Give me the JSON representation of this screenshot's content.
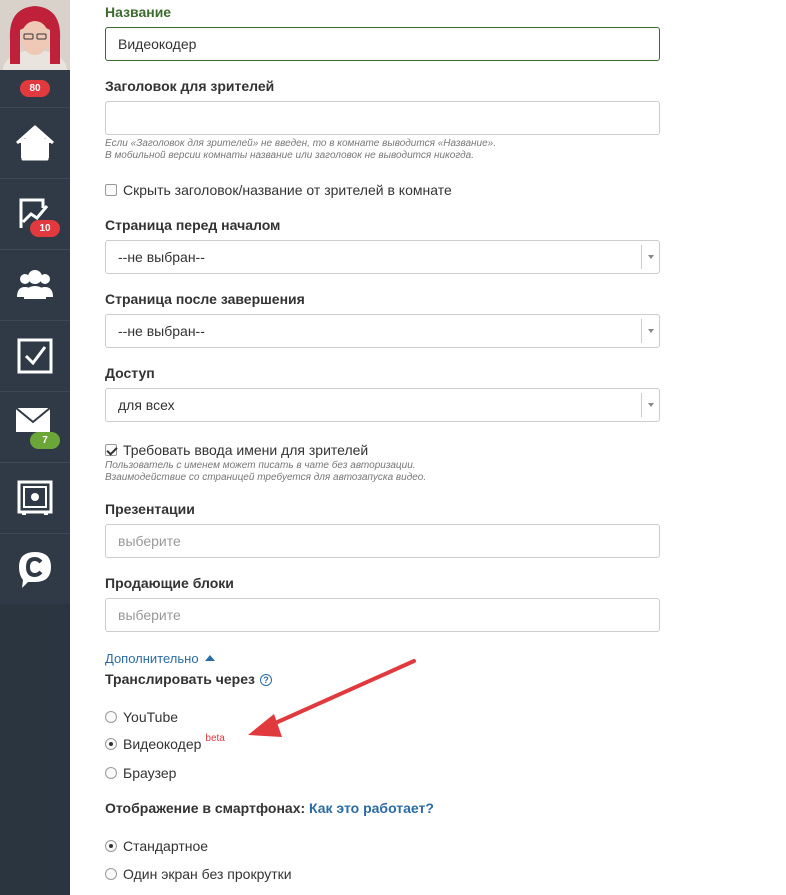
{
  "sidebar": {
    "avatar_badge": "80",
    "items": [
      {
        "icon": "home-icon",
        "badge": ""
      },
      {
        "icon": "chart-icon",
        "badge": "10"
      },
      {
        "icon": "users-icon",
        "badge": ""
      },
      {
        "icon": "checkbox-icon",
        "badge": ""
      },
      {
        "icon": "mail-icon",
        "badge": "7"
      },
      {
        "icon": "safe-icon",
        "badge": ""
      },
      {
        "icon": "chat-c-icon",
        "badge": ""
      }
    ]
  },
  "form": {
    "name_label": "Название",
    "name_value": "Видеокодер",
    "title_label": "Заголовок для зрителей",
    "title_value": "",
    "title_hint_1": "Если «Заголовок для зрителей» не введен, то в комнате выводится «Название».",
    "title_hint_2": "В мобильной версии комнаты название или заголовок не выводится никогда.",
    "hide_title_label": "Скрыть заголовок/название от зрителей в комнате",
    "page_before_label": "Страница перед началом",
    "page_before_value": "--не выбран--",
    "page_after_label": "Страница после завершения",
    "page_after_value": "--не выбран--",
    "access_label": "Доступ",
    "access_value": "для всех",
    "require_name_label": "Требовать ввода имени для зрителей",
    "require_name_hint_1": "Пользователь с именем может писать в чате без авторизации.",
    "require_name_hint_2": "Взаимодействие со страницей требуется для автозапуска видео.",
    "presentations_label": "Презентации",
    "presentations_placeholder": "выберите",
    "selling_label": "Продающие блоки",
    "selling_placeholder": "выберите",
    "more_link": "Дополнительно",
    "broadcast_label": "Транслировать через",
    "broadcast_help": "?",
    "broadcast_options": [
      {
        "label": "YouTube",
        "selected": false
      },
      {
        "label": "Видеокодер",
        "selected": true,
        "tag": "beta"
      },
      {
        "label": "Браузер",
        "selected": false
      }
    ],
    "mobile_label": "Отображение в смартфонах:",
    "mobile_link": "Как это работает?",
    "mobile_options": [
      {
        "label": "Стандартное",
        "selected": true
      },
      {
        "label": "Один экран без прокрутки",
        "selected": false
      }
    ]
  },
  "colors": {
    "sidebar_bg": "#2f3a46",
    "active_border": "#3e6b2e",
    "link": "#2b6ba5",
    "badge_red": "#e0393e",
    "badge_green": "#6aa738",
    "annotation_arrow": "#e0393e"
  }
}
